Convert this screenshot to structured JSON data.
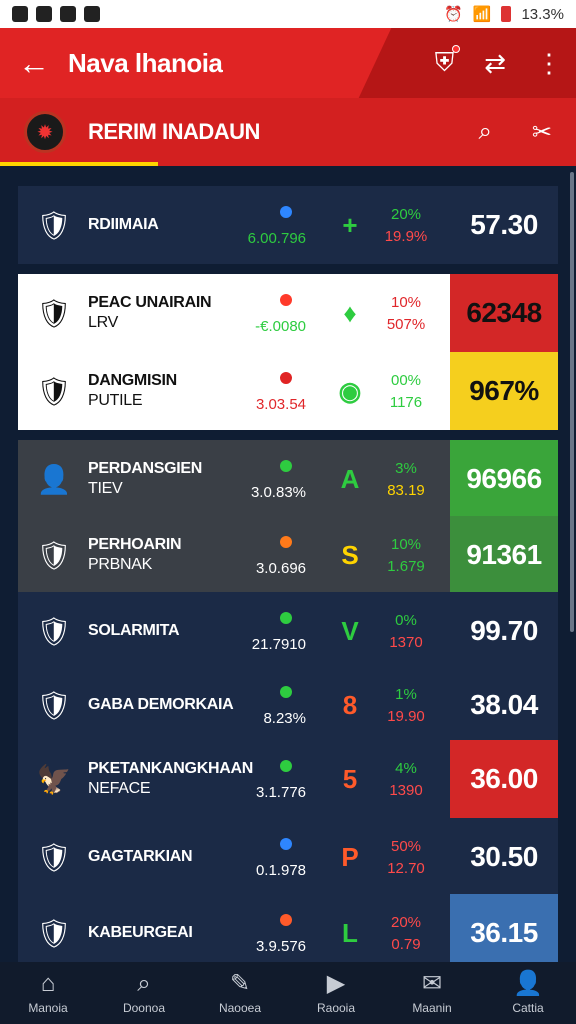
{
  "statusbar": {
    "battery": "13.3%"
  },
  "appbar": {
    "back_icon": "arrow-left-icon",
    "title": "Nava lhanoia",
    "icons": [
      "shield-icon",
      "share-icon",
      "more-icon"
    ]
  },
  "subbar": {
    "title": "RERIM INADAUN",
    "icons": [
      "search-icon",
      "share-icon"
    ]
  },
  "rows": [
    {
      "name": "RDIIMAIA",
      "sub": "",
      "dot_color": "#2e86ff",
      "change": "6.00.796",
      "change_color": "#2ecc40",
      "trend": "+",
      "trend_color": "#2ecc40",
      "pct_top": "20%",
      "pct_top_color": "#2ecc40",
      "pct_bottom": "19.9%",
      "pct_bottom_color": "#ff4a4a",
      "score": "57.30",
      "score_bg": "#1b2a46",
      "crest_icon": "crest-icon",
      "style": "dark"
    },
    {
      "name": "PEAC UNAIRAIN",
      "sub": "LRV",
      "dot_color": "#ff3a2a",
      "change": "-€.0080",
      "change_color": "#2ecc40",
      "trend": "♦",
      "trend_color": "#2ecc40",
      "pct_top": "10%",
      "pct_top_color": "#e0262a",
      "pct_bottom": "507%",
      "pct_bottom_color": "#e0262a",
      "score": "62348",
      "score_bg": "#d32727",
      "crest_icon": "crest-icon",
      "style": "white"
    },
    {
      "name": "DANGMISIN",
      "sub": "PUTILE",
      "dot_color": "#e02424",
      "change": "3.03.54",
      "change_color": "#e0262a",
      "trend": "◉",
      "trend_color": "#2ecc40",
      "pct_top": "00%",
      "pct_top_color": "#2ecc40",
      "pct_bottom": "1176",
      "pct_bottom_color": "#2ecc40",
      "score": "967%",
      "score_bg": "#f5cf1e",
      "crest_icon": "crest-icon",
      "style": "white"
    },
    {
      "name": "PERDANSGIEN",
      "sub": "TIEV",
      "dot_color": "#2ecc40",
      "change": "3.0.83%",
      "change_color": "#ffffff",
      "trend": "A",
      "trend_color": "#2ecc40",
      "pct_top": "3%",
      "pct_top_color": "#2ecc40",
      "pct_bottom": "83.19",
      "pct_bottom_color": "#ffd400",
      "score": "96966",
      "score_bg": "#3aa53a",
      "crest_icon": "player-avatar-icon",
      "style": "grey"
    },
    {
      "name": "PERHOARIN",
      "sub": "PRBNAK",
      "dot_color": "#ff7a1a",
      "change": "3.0.696",
      "change_color": "#ffffff",
      "trend": "S",
      "trend_color": "#ffd400",
      "pct_top": "10%",
      "pct_top_color": "#2ecc40",
      "pct_bottom": "1.679",
      "pct_bottom_color": "#2ecc40",
      "score": "91361",
      "score_bg": "#3c8f3c",
      "crest_icon": "crest-icon",
      "style": "grey"
    },
    {
      "name": "SOLARMITA",
      "sub": "",
      "dot_color": "#2ecc40",
      "change": "21.7910",
      "change_color": "#ffffff",
      "trend": "V",
      "trend_color": "#2ecc40",
      "pct_top": "0%",
      "pct_top_color": "#2ecc40",
      "pct_bottom": "1370",
      "pct_bottom_color": "#ff4a4a",
      "score": "99.70",
      "score_bg": "#1b2a46",
      "crest_icon": "crest-icon",
      "style": "dark"
    },
    {
      "name": "GABA DEMORKAIA",
      "sub": "",
      "dot_color": "#2ecc40",
      "change": "8.23%",
      "change_color": "#ffffff",
      "trend": "8",
      "trend_color": "#ff5a2a",
      "pct_top": "1%",
      "pct_top_color": "#2ecc40",
      "pct_bottom": "19.90",
      "pct_bottom_color": "#ff4a4a",
      "score": "38.04",
      "score_bg": "#1b2a46",
      "crest_icon": "crest-icon",
      "style": "dark"
    },
    {
      "name": "PKETANKANGKHAAN",
      "sub": "NEFACE",
      "dot_color": "#2ecc40",
      "change": "3.1.776",
      "change_color": "#ffffff",
      "trend": "5",
      "trend_color": "#ff5a2a",
      "pct_top": "4%",
      "pct_top_color": "#2ecc40",
      "pct_bottom": "1390",
      "pct_bottom_color": "#ff4a4a",
      "score": "36.00",
      "score_bg": "#d32727",
      "crest_icon": "crest-icon",
      "style": "dark"
    },
    {
      "name": "GAGTARKIAN",
      "sub": "",
      "dot_color": "#2e86ff",
      "change": "0.1.978",
      "change_color": "#ffffff",
      "trend": "P",
      "trend_color": "#ff5a2a",
      "pct_top": "50%",
      "pct_top_color": "#ff4a4a",
      "pct_bottom": "12.70",
      "pct_bottom_color": "#ff4a4a",
      "score": "30.50",
      "score_bg": "#1b2a46",
      "crest_icon": "crest-icon",
      "style": "dark"
    },
    {
      "name": "KABEURGEAI",
      "sub": "",
      "dot_color": "#ff5a2a",
      "change": "3.9.576",
      "change_color": "#ffffff",
      "trend": "L",
      "trend_color": "#2ecc40",
      "pct_top": "20%",
      "pct_top_color": "#ff4a4a",
      "pct_bottom": "0.79",
      "pct_bottom_color": "#ff4a4a",
      "score": "36.15",
      "score_bg": "#3a6fb0",
      "crest_icon": "crest-icon",
      "style": "dark"
    }
  ],
  "bottomnav": [
    {
      "label": "Manoia",
      "icon": "home-icon"
    },
    {
      "label": "Doonoa",
      "icon": "search-icon"
    },
    {
      "label": "Naooea",
      "icon": "edit-icon"
    },
    {
      "label": "Raooia",
      "icon": "play-icon"
    },
    {
      "label": "Maanin",
      "icon": "message-icon"
    },
    {
      "label": "Cattia",
      "icon": "profile-icon"
    }
  ]
}
